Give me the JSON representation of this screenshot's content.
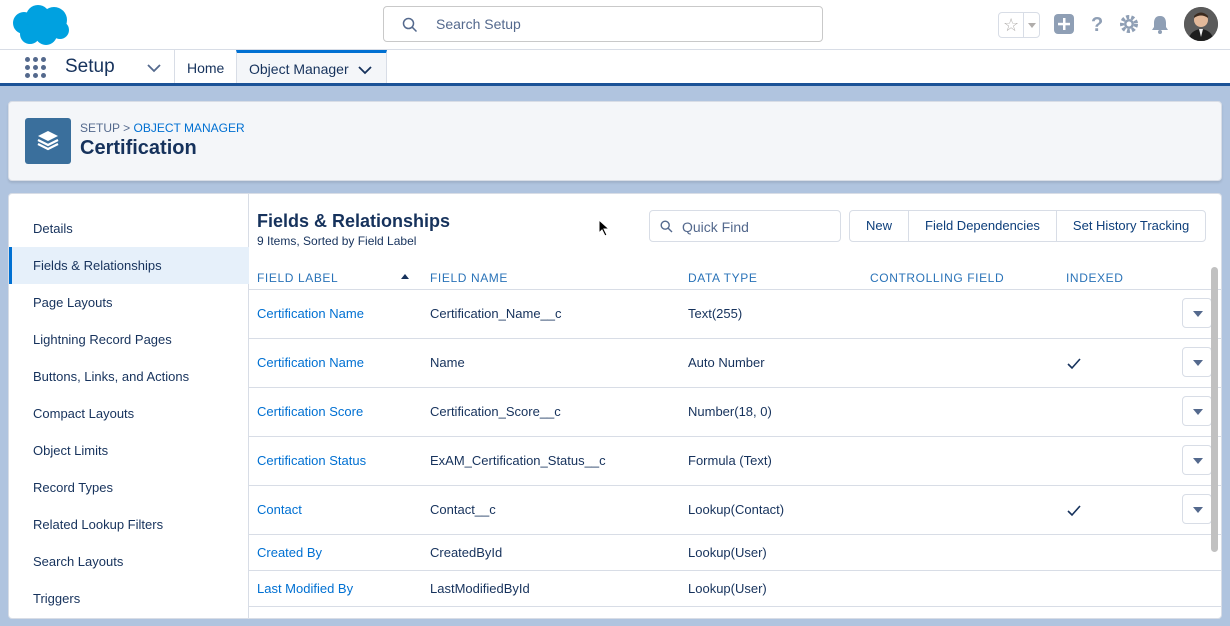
{
  "header": {
    "search_placeholder": "Search Setup",
    "icons": [
      "salesforce-logo",
      "favorites-star-icon",
      "add-icon",
      "help-icon",
      "gear-icon",
      "bell-icon",
      "avatar"
    ]
  },
  "context_bar": {
    "app_name": "Setup",
    "tabs": [
      {
        "label": "Home"
      },
      {
        "label": "Object Manager"
      }
    ]
  },
  "page_header": {
    "breadcrumb_root": "SETUP",
    "breadcrumb_sep": " > ",
    "breadcrumb_link": "OBJECT MANAGER",
    "title": "Certification"
  },
  "sidebar": {
    "items": [
      {
        "label": "Details"
      },
      {
        "label": "Fields & Relationships"
      },
      {
        "label": "Page Layouts"
      },
      {
        "label": "Lightning Record Pages"
      },
      {
        "label": "Buttons, Links, and Actions"
      },
      {
        "label": "Compact Layouts"
      },
      {
        "label": "Object Limits"
      },
      {
        "label": "Record Types"
      },
      {
        "label": "Related Lookup Filters"
      },
      {
        "label": "Search Layouts"
      },
      {
        "label": "Triggers"
      }
    ]
  },
  "section": {
    "title": "Fields & Relationships",
    "subtitle": "9 Items, Sorted by Field Label",
    "quick_find_placeholder": "Quick Find",
    "buttons": [
      "New",
      "Field Dependencies",
      "Set History Tracking"
    ]
  },
  "table": {
    "columns": [
      "FIELD LABEL",
      "FIELD NAME",
      "DATA TYPE",
      "CONTROLLING FIELD",
      "INDEXED"
    ],
    "rows": [
      {
        "label": "Certification Name",
        "name": "Certification_Name__c",
        "type": "Text(255)",
        "controlling": "",
        "indexed": false
      },
      {
        "label": "Certification Name",
        "name": "Name",
        "type": "Auto Number",
        "controlling": "",
        "indexed": true
      },
      {
        "label": "Certification Score",
        "name": "Certification_Score__c",
        "type": "Number(18, 0)",
        "controlling": "",
        "indexed": false
      },
      {
        "label": "Certification Status",
        "name": "ExAM_Certification_Status__c",
        "type": "Formula (Text)",
        "controlling": "",
        "indexed": false
      },
      {
        "label": "Contact",
        "name": "Contact__c",
        "type": "Lookup(Contact)",
        "controlling": "",
        "indexed": true
      },
      {
        "label": "Created By",
        "name": "CreatedById",
        "type": "Lookup(User)",
        "controlling": "",
        "indexed": false
      },
      {
        "label": "Last Modified By",
        "name": "LastModifiedById",
        "type": "Lookup(User)",
        "controlling": "",
        "indexed": false
      }
    ]
  },
  "colors": {
    "brand_blue": "#0070d2",
    "text_dark": "#16325c",
    "background": "#b0c4df",
    "object_icon": "#3a6f9c"
  }
}
